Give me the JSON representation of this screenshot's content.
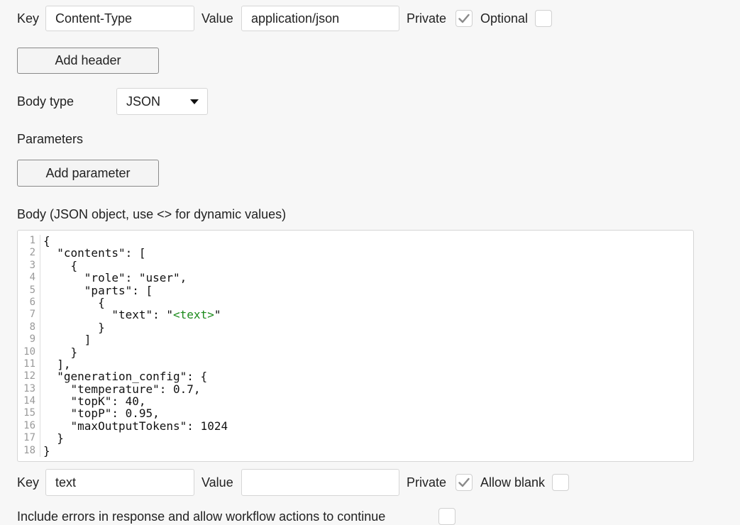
{
  "header_row": {
    "key_label": "Key",
    "key_value": "Content-Type",
    "value_label": "Value",
    "value_value": "application/json",
    "private_label": "Private",
    "private_checked": true,
    "optional_label": "Optional",
    "optional_checked": false
  },
  "add_header_label": "Add header",
  "body_type": {
    "label": "Body type",
    "selected": "JSON"
  },
  "parameters_label": "Parameters",
  "add_parameter_label": "Add parameter",
  "body_label": "Body (JSON object, use <> for dynamic values)",
  "editor": {
    "lines": [
      {
        "num": "1",
        "pre": "{",
        "dyn": "",
        "post": ""
      },
      {
        "num": "2",
        "pre": "  \"contents\": [",
        "dyn": "",
        "post": ""
      },
      {
        "num": "3",
        "pre": "    {",
        "dyn": "",
        "post": ""
      },
      {
        "num": "4",
        "pre": "      \"role\": \"user\",",
        "dyn": "",
        "post": ""
      },
      {
        "num": "5",
        "pre": "      \"parts\": [",
        "dyn": "",
        "post": ""
      },
      {
        "num": "6",
        "pre": "        {",
        "dyn": "",
        "post": ""
      },
      {
        "num": "7",
        "pre": "          \"text\": \"",
        "dyn": "<text>",
        "post": "\""
      },
      {
        "num": "8",
        "pre": "        }",
        "dyn": "",
        "post": ""
      },
      {
        "num": "9",
        "pre": "      ]",
        "dyn": "",
        "post": ""
      },
      {
        "num": "10",
        "pre": "    }",
        "dyn": "",
        "post": ""
      },
      {
        "num": "11",
        "pre": "  ],",
        "dyn": "",
        "post": ""
      },
      {
        "num": "12",
        "pre": "  \"generation_config\": {",
        "dyn": "",
        "post": ""
      },
      {
        "num": "13",
        "pre": "    \"temperature\": 0.7,",
        "dyn": "",
        "post": ""
      },
      {
        "num": "14",
        "pre": "    \"topK\": 40,",
        "dyn": "",
        "post": ""
      },
      {
        "num": "15",
        "pre": "    \"topP\": 0.95,",
        "dyn": "",
        "post": ""
      },
      {
        "num": "16",
        "pre": "    \"maxOutputTokens\": 1024",
        "dyn": "",
        "post": ""
      },
      {
        "num": "17",
        "pre": "  }",
        "dyn": "",
        "post": ""
      },
      {
        "num": "18",
        "pre": "}",
        "dyn": "",
        "post": ""
      }
    ]
  },
  "param_row": {
    "key_label": "Key",
    "key_value": "text",
    "value_label": "Value",
    "value_value": "",
    "private_label": "Private",
    "private_checked": true,
    "allow_blank_label": "Allow blank",
    "allow_blank_checked": false
  },
  "include_errors_label": "Include errors in response and allow workflow actions to continue",
  "include_errors_checked": false,
  "colors": {
    "background": "#f7f7f7",
    "dynamic_value": "#1a8a1a",
    "checkmark": "#8a8a8a"
  }
}
